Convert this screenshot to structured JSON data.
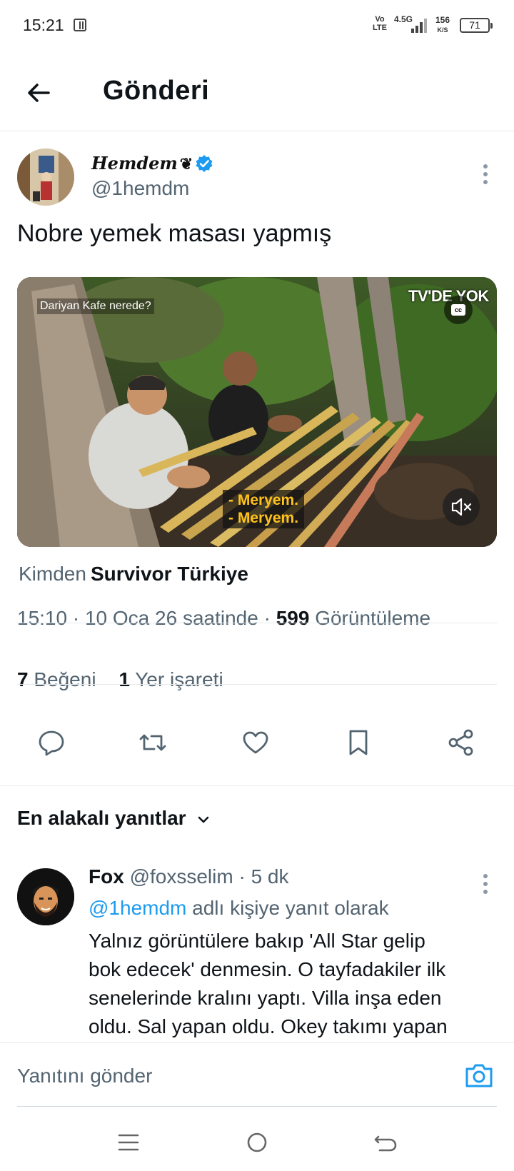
{
  "status_bar": {
    "time": "15:21",
    "volte": "Vo LTE",
    "network": "4.5G",
    "speed_value": "156",
    "speed_unit": "K/S",
    "battery": "71"
  },
  "header": {
    "title": "Gönderi",
    "back_icon": "arrow-left-icon"
  },
  "post": {
    "display_name": "Hemdem",
    "display_name_emoji": "❦",
    "verified": true,
    "handle": "@1hemdm",
    "text": "Nobre yemek masası yapmış",
    "media": {
      "caption_top": "Dariyan Kafe nerede?",
      "channel_logo": "TV'DE YOK",
      "cc_label": "cc",
      "subtitles": [
        "- Meryem.",
        "- Meryem."
      ]
    },
    "source_prefix": "Kimden",
    "source_name": "Survivor Türkiye",
    "time": "15:10",
    "date": "10 Oca 26 saatinde",
    "views_count": "599",
    "views_label": "Görüntüleme",
    "likes_count": "7",
    "likes_label": "Beğeni",
    "bookmarks_count": "1",
    "bookmarks_label": "Yer işareti"
  },
  "actions": [
    "reply-icon",
    "retweet-icon",
    "like-icon",
    "bookmark-icon",
    "share-icon"
  ],
  "replies_sort": "En alakalı yanıtlar",
  "reply": {
    "name": "Fox",
    "handle": "@foxsselim",
    "time": "5 dk",
    "reply_to_mention": "@1hemdm",
    "reply_to_suffix": "adlı kişiye yanıt olarak",
    "lines": [
      "Yalnız görüntülere bakıp 'All Star gelip",
      "bok edecek' denmesin. O tayfadakiler ilk",
      "senelerinde kralını yaptı. Villa inşa eden",
      "oldu. Sal yapan oldu. Okey takımı yapan"
    ]
  },
  "compose": {
    "placeholder": "Yanıtını gönder"
  },
  "colors": {
    "accent": "#1d9bf0",
    "text": "#0f1419",
    "secondary": "#536471",
    "subtitle_yellow": "#ffc21a"
  }
}
